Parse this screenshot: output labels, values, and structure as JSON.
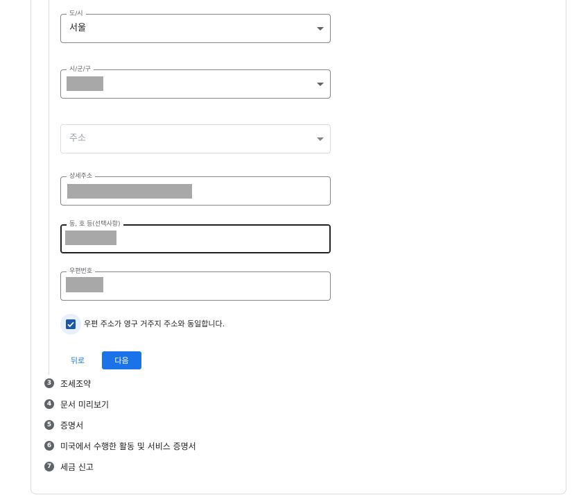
{
  "form": {
    "city": {
      "label": "도/시",
      "value": "서울"
    },
    "district": {
      "label": "시/군/구"
    },
    "address": {
      "placeholder": "주소"
    },
    "detail_address": {
      "label": "상세주소"
    },
    "unit": {
      "label": "동, 호 등(선택사항)"
    },
    "postal_code": {
      "label": "우편번호"
    },
    "same_address_checkbox": {
      "label": "우편 주소가 영구 거주지 주소와 동일합니다.",
      "checked": true
    },
    "back_label": "뒤로",
    "next_label": "다음"
  },
  "steps": [
    {
      "number": "3",
      "label": "조세조약"
    },
    {
      "number": "4",
      "label": "문서 미리보기"
    },
    {
      "number": "5",
      "label": "증명서"
    },
    {
      "number": "6",
      "label": "미국에서 수행한 활동 및 서비스 증명서"
    },
    {
      "number": "7",
      "label": "세금 신고"
    }
  ],
  "colors": {
    "accent": "#1a73e8",
    "checkbox": "#1a57a6",
    "step_badge": "#5f6368"
  }
}
